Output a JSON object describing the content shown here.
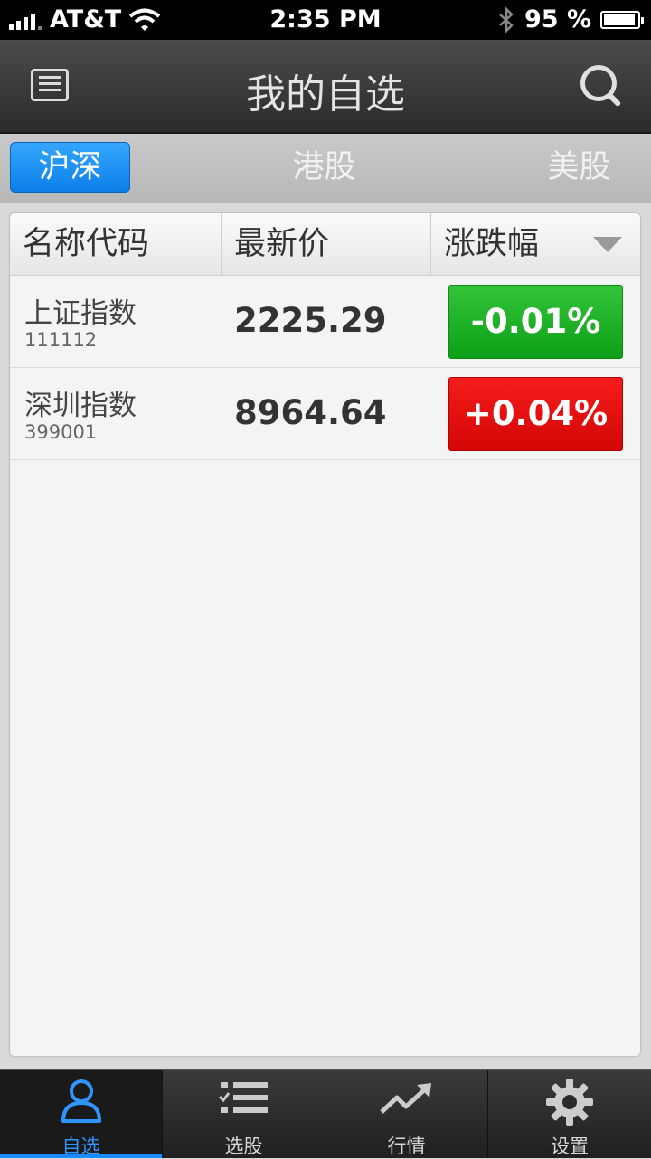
{
  "status_bar": {
    "carrier": "AT&T",
    "time": "2:35 PM",
    "battery_percent": "95 %",
    "battery_level": 0.95,
    "icons": [
      "signal-icon",
      "wifi-icon",
      "bluetooth-icon",
      "battery-icon"
    ]
  },
  "nav": {
    "title": "我的自选",
    "left_icon": "list-icon",
    "right_icon": "search-icon"
  },
  "segments": [
    {
      "label": "沪深",
      "active": true
    },
    {
      "label": "港股",
      "active": false
    },
    {
      "label": "美股",
      "active": false
    }
  ],
  "table": {
    "columns": [
      "名称代码",
      "最新价",
      "涨跌幅"
    ],
    "sort_icon": "sort-down-icon",
    "rows": [
      {
        "name": "上证指数",
        "code": "111112",
        "price": "2225.29",
        "change": "-0.01%",
        "direction": "down",
        "color": "#1aad24"
      },
      {
        "name": "深圳指数",
        "code": "399001",
        "price": "8964.64",
        "change": "+0.04%",
        "direction": "up",
        "color": "#e60a0a"
      }
    ]
  },
  "tabbar": {
    "active_color": "#1a8cff",
    "items": [
      {
        "label": "自选",
        "icon": "user-icon",
        "active": true
      },
      {
        "label": "选股",
        "icon": "checklist-icon",
        "active": false
      },
      {
        "label": "行情",
        "icon": "trend-icon",
        "active": false
      },
      {
        "label": "设置",
        "icon": "gear-icon",
        "active": false
      }
    ]
  }
}
